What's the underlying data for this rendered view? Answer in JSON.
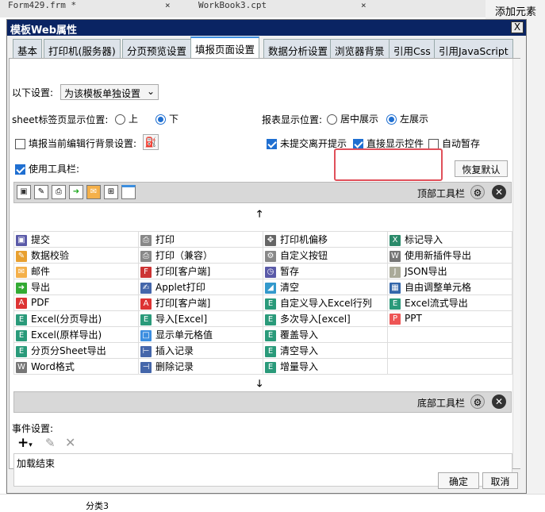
{
  "background": {
    "tabs": [
      "Form429.frm *",
      "WorkBook3.cpt"
    ],
    "side_label": "添加元素",
    "sheet_cell": "分类3"
  },
  "dialog": {
    "title": "模板Web属性",
    "close": "X",
    "tabs": [
      "基本",
      "打印机(服务器)",
      "分页预览设置",
      "填报页面设置",
      "数据分析设置",
      "浏览器背景",
      "引用Css",
      "引用JavaScript"
    ],
    "active_tab": 3,
    "settings_label": "以下设置:",
    "settings_value": "为该模板单独设置",
    "sheet_pos_label": "sheet标签页显示位置:",
    "sheet_pos_options": [
      "上",
      "下"
    ],
    "sheet_pos_selected": "下",
    "report_pos_label": "报表显示位置:",
    "report_pos_options": [
      "居中展示",
      "左展示"
    ],
    "report_pos_selected": "左展示",
    "bg_setting_label": "填报当前编辑行背景设置:",
    "bg_setting_checked": false,
    "unsubmitted_label": "未提交离开提示",
    "unsubmitted_checked": true,
    "direct_show_label": "直接显示控件",
    "direct_show_checked": true,
    "autosave_label": "自动暂存",
    "autosave_checked": false,
    "use_toolbar_label": "使用工具栏:",
    "use_toolbar_checked": true,
    "restore_default": "恢复默认",
    "top_toolbar_label": "顶部工具栏",
    "bottom_toolbar_label": "底部工具栏",
    "buttons": [
      [
        "提交",
        "打印",
        "打印机偏移",
        "标记导入"
      ],
      [
        "数据校验",
        "打印（兼容）",
        "自定义按钮",
        "使用新插件导出"
      ],
      [
        "邮件",
        "打印[客户端]",
        "暂存",
        "JSON导出"
      ],
      [
        "导出",
        "Applet打印",
        "清空",
        "自由调整单元格"
      ],
      [
        "PDF",
        "打印[客户端]",
        "自定义导入Excel行列",
        "Excel流式导出"
      ],
      [
        "Excel(分页导出)",
        "导入[Excel]",
        "多次导入[excel]",
        "PPT"
      ],
      [
        "Excel(原样导出)",
        "显示单元格值",
        "覆盖导入",
        ""
      ],
      [
        "分页分Sheet导出",
        "插入记录",
        "清空导入",
        ""
      ],
      [
        "Word格式",
        "删除记录",
        "增量导入",
        ""
      ]
    ],
    "icons": [
      [
        "save-icon",
        "printer-icon",
        "move-icon",
        "excel-mark-icon"
      ],
      [
        "pencil-icon",
        "printer-icon",
        "gear-icon",
        "word-icon"
      ],
      [
        "mail-icon",
        "flash-print-icon",
        "save-clock-icon",
        "json-icon"
      ],
      [
        "export-icon",
        "applet-icon",
        "eraser-icon",
        "grid-icon"
      ],
      [
        "pdf-icon",
        "pdf-print-icon",
        "excel-icon",
        "excel-icon"
      ],
      [
        "excel-icon",
        "excel-icon",
        "excel-icon",
        "ppt-icon"
      ],
      [
        "excel-icon",
        "cell-icon",
        "excel-icon",
        ""
      ],
      [
        "excel-icon",
        "insert-row-icon",
        "excel-icon",
        ""
      ],
      [
        "word-icon",
        "delete-row-icon",
        "excel-icon",
        ""
      ]
    ],
    "events_label": "事件设置:",
    "events": [
      "加载结束"
    ],
    "ok": "确定",
    "cancel": "取消"
  },
  "colors": {
    "title_bar": "#0a2463",
    "accent": "#1f6fd1",
    "highlight": "#e0505a"
  }
}
